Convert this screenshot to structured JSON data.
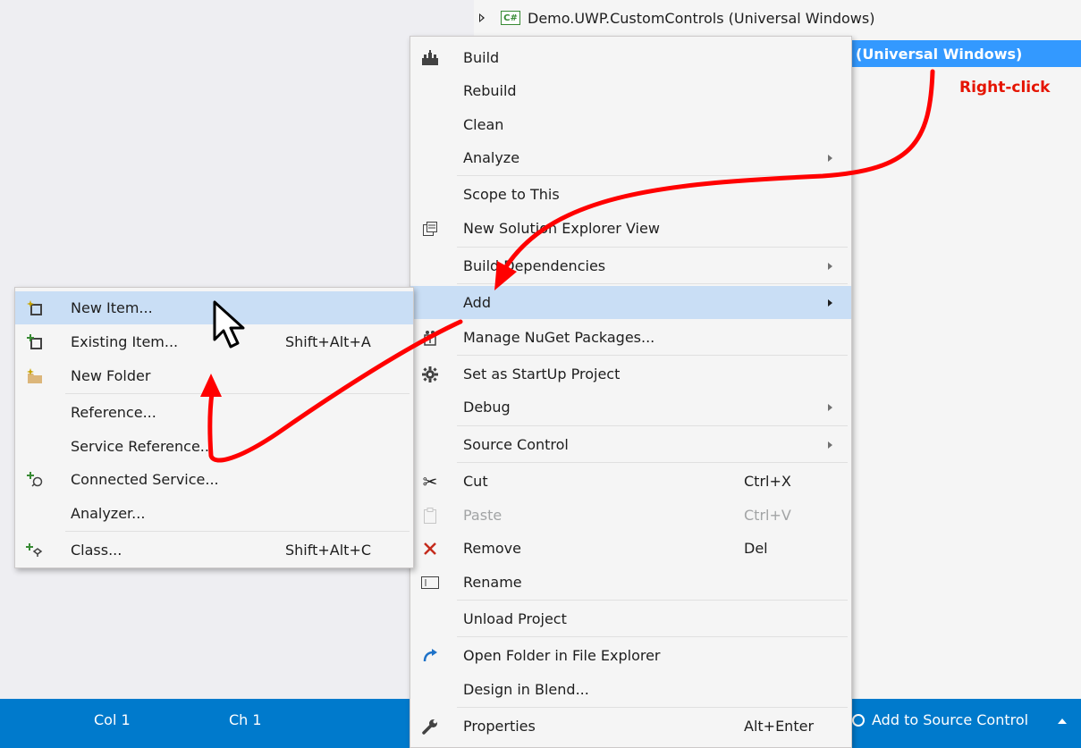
{
  "solution_explorer": {
    "items": [
      {
        "label": "Demo.UWP.CustomControls (Universal Windows)"
      },
      {
        "label": "(Universal Windows)"
      }
    ]
  },
  "annotation": {
    "text": "Right-click",
    "color": "#e51400"
  },
  "context_menu": {
    "items": [
      {
        "label": "Build",
        "icon": "build-icon"
      },
      {
        "label": "Rebuild"
      },
      {
        "label": "Clean"
      },
      {
        "label": "Analyze",
        "has_submenu": true
      },
      {
        "label": "Scope to This"
      },
      {
        "label": "New Solution Explorer View",
        "icon": "new-view-icon"
      },
      {
        "label": "Build Dependencies",
        "has_submenu": true
      },
      {
        "label": "Add",
        "has_submenu": true,
        "highlighted": true
      },
      {
        "label": "Manage NuGet Packages...",
        "icon": "nuget-icon"
      },
      {
        "label": "Set as StartUp Project",
        "icon": "gear-icon"
      },
      {
        "label": "Debug",
        "has_submenu": true
      },
      {
        "label": "Source Control",
        "has_submenu": true
      },
      {
        "label": "Cut",
        "shortcut": "Ctrl+X",
        "icon": "scissors-icon"
      },
      {
        "label": "Paste",
        "shortcut": "Ctrl+V",
        "icon": "paste-icon",
        "disabled": true
      },
      {
        "label": "Remove",
        "shortcut": "Del",
        "icon": "remove-icon"
      },
      {
        "label": "Rename",
        "icon": "rename-icon"
      },
      {
        "label": "Unload Project"
      },
      {
        "label": "Open Folder in File Explorer",
        "icon": "open-folder-icon"
      },
      {
        "label": "Design in Blend..."
      },
      {
        "label": "Properties",
        "shortcut": "Alt+Enter",
        "icon": "wrench-icon"
      }
    ]
  },
  "add_submenu": {
    "items": [
      {
        "label": "New Item...",
        "icon": "new-item-icon",
        "highlighted": true
      },
      {
        "label": "Existing Item...",
        "shortcut": "Shift+Alt+A",
        "icon": "existing-item-icon"
      },
      {
        "label": "New Folder",
        "icon": "new-folder-icon"
      },
      {
        "label": "Reference..."
      },
      {
        "label": "Service Reference..."
      },
      {
        "label": "Connected Service...",
        "icon": "connected-service-icon"
      },
      {
        "label": "Analyzer..."
      },
      {
        "label": "Class...",
        "shortcut": "Shift+Alt+C",
        "icon": "class-icon"
      }
    ]
  },
  "status_bar": {
    "col": "Col 1",
    "ch": "Ch 1",
    "source_control": "Add to Source Control",
    "background": "#007acc"
  }
}
